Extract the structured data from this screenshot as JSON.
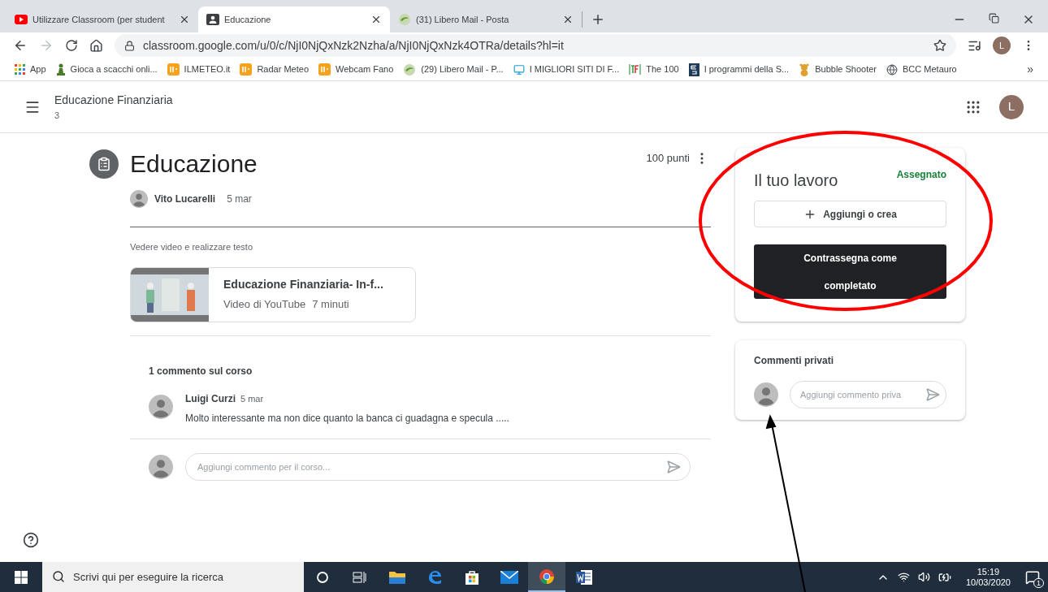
{
  "browser": {
    "tabs": [
      {
        "title": "Utilizzare Classroom (per student",
        "kind": "youtube",
        "selected": false
      },
      {
        "title": "Educazione",
        "kind": "classroom",
        "selected": true
      },
      {
        "title": "(31) Libero Mail - Posta",
        "kind": "libero",
        "selected": false
      }
    ],
    "address": "classroom.google.com/u/0/c/NjI0NjQxNzk2Nzha/a/NjI0NjQxNzk4OTRa/details?hl=it",
    "profile_initial": "L",
    "bookmarks": [
      {
        "label": "App",
        "kind": "apps"
      },
      {
        "label": "Gioca a scacchi onli...",
        "kind": "chess"
      },
      {
        "label": "ILMETEO.it",
        "kind": "meteo"
      },
      {
        "label": "Radar Meteo",
        "kind": "meteo"
      },
      {
        "label": "Webcam Fano",
        "kind": "meteo"
      },
      {
        "label": "(29) Libero Mail - P...",
        "kind": "libero"
      },
      {
        "label": "I MIGLIORI SITI DI F...",
        "kind": "monitor"
      },
      {
        "label": "The 100",
        "kind": "tf"
      },
      {
        "label": "I programmi della S...",
        "kind": "es"
      },
      {
        "label": "Bubble Shooter",
        "kind": "bear"
      },
      {
        "label": "BCC Metauro",
        "kind": "globe"
      }
    ],
    "bookmarks_overflow": "»"
  },
  "header": {
    "class_name": "Educazione Finanziaria",
    "section": "3",
    "profile_initial": "L"
  },
  "assignment": {
    "title": "Educazione",
    "points": "100 punti",
    "author": "Vito Lucarelli",
    "date": "5 mar",
    "description": "Vedere video e realizzare testo",
    "attachment": {
      "title": "Educazione Finanziaria- In-f...",
      "source": "Video di YouTube",
      "duration": "7 minuti"
    },
    "comments_heading": "1 commento sul corso",
    "comments": [
      {
        "author": "Luigi Curzi",
        "date": "5 mar",
        "text": "Molto interessante ma non dice quanto la banca ci guadagna e specula ....."
      }
    ],
    "comment_placeholder": "Aggiungi commento per il corso..."
  },
  "your_work": {
    "title": "Il tuo lavoro",
    "status": "Assegnato",
    "add_button": "Aggiungi o crea",
    "mark_button": "Contrassegna come completato"
  },
  "private_comments": {
    "heading": "Commenti privati",
    "placeholder": "Aggiungi commento priva"
  },
  "taskbar": {
    "search_placeholder": "Scrivi qui per eseguire la ricerca",
    "time": "15:19",
    "date": "10/03/2020",
    "notifications": "1",
    "apps": [
      {
        "kind": "cortana",
        "selected": false
      },
      {
        "kind": "taskview",
        "selected": false
      },
      {
        "kind": "explorer",
        "selected": false
      },
      {
        "kind": "edge",
        "selected": false
      },
      {
        "kind": "store",
        "selected": false
      },
      {
        "kind": "mail",
        "selected": false
      },
      {
        "kind": "chrome",
        "selected": true
      },
      {
        "kind": "word",
        "selected": false
      }
    ]
  }
}
